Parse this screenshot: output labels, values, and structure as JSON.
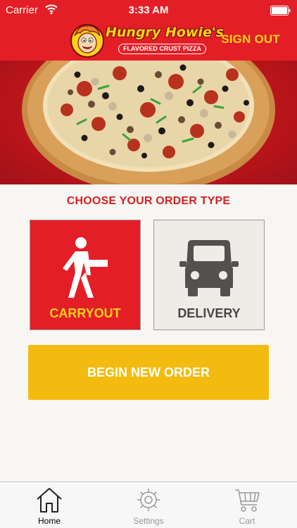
{
  "status_bar": {
    "carrier": "Carrier",
    "time": "3:33 AM"
  },
  "header": {
    "logo_name": "Hungry Howie's",
    "logo_tagline": "FLAVORED CRUST PIZZA",
    "sign_out_label": "SIGN OUT"
  },
  "colors": {
    "brand_red": "#e41e26",
    "accent_yellow": "#ffd21a",
    "button_gold": "#f3bb0f"
  },
  "order": {
    "title": "CHOOSE YOUR ORDER TYPE",
    "types": [
      {
        "label": "CARRYOUT",
        "icon": "walking-person-icon",
        "selected": true
      },
      {
        "label": "DELIVERY",
        "icon": "car-icon",
        "selected": false
      }
    ],
    "begin_label": "BEGIN NEW ORDER"
  },
  "tab_bar": {
    "tabs": [
      {
        "label": "Home",
        "icon": "home-icon",
        "active": true
      },
      {
        "label": "Settings",
        "icon": "gear-icon",
        "active": false
      },
      {
        "label": "Cart",
        "icon": "cart-icon",
        "active": false
      }
    ]
  }
}
